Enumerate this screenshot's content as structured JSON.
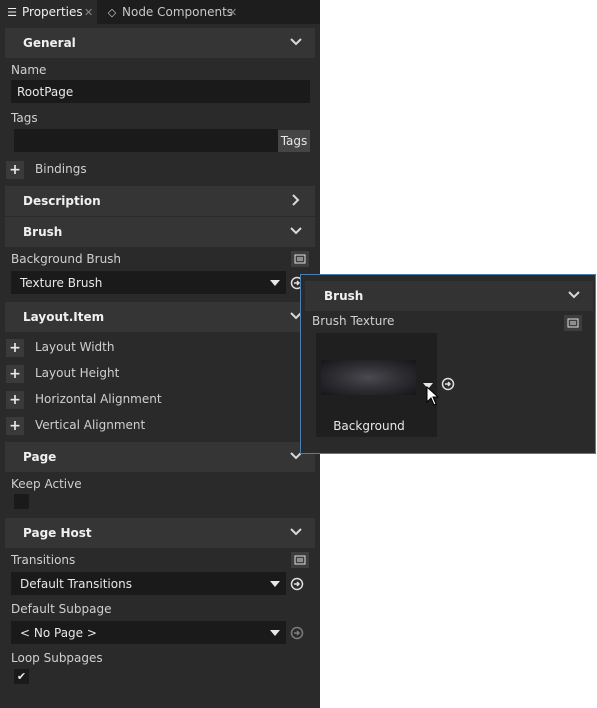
{
  "tabs": [
    {
      "label": "Properties",
      "icon": "list-icon"
    },
    {
      "label": "Node Components",
      "icon": "components-icon"
    }
  ],
  "sections": {
    "general": "General",
    "description": "Description",
    "brush": "Brush",
    "layout_item": "Layout.Item",
    "page": "Page",
    "page_host": "Page Host"
  },
  "general": {
    "name_label": "Name",
    "name_value": "RootPage",
    "tags_label": "Tags",
    "tags_value": "",
    "tags_button": "Tags",
    "bindings_label": "Bindings"
  },
  "brush": {
    "background_brush_label": "Background Brush",
    "background_brush_value": "Texture Brush"
  },
  "layout_item": {
    "properties": [
      "Layout Width",
      "Layout Height",
      "Horizontal Alignment",
      "Vertical Alignment"
    ]
  },
  "page": {
    "keep_active_label": "Keep Active",
    "keep_active_checked": false
  },
  "page_host": {
    "transitions_label": "Transitions",
    "transitions_value": "Default Transitions",
    "default_subpage_label": "Default Subpage",
    "default_subpage_value": "< No Page >",
    "loop_subpages_label": "Loop Subpages",
    "loop_subpages_checked": true
  },
  "popup": {
    "section_title": "Brush",
    "brush_texture_label": "Brush Texture",
    "texture_caption": "Background"
  },
  "colors": {
    "panel_bg": "#2a2a2a",
    "section_bg": "#353535",
    "field_bg": "#1a1a1a",
    "popup_border": "#4a7fb0"
  }
}
